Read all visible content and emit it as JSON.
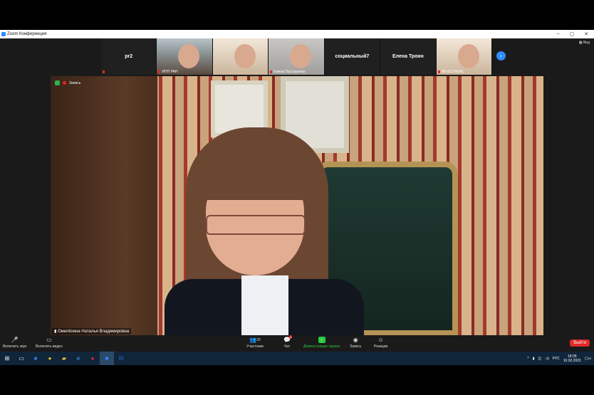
{
  "window": {
    "title": "Zoom Конференция",
    "controls": [
      "–",
      "▢",
      "✕"
    ]
  },
  "view_button": "Вид",
  "gallery": [
    {
      "type": "name",
      "label": "pr2",
      "muted": true
    },
    {
      "type": "video",
      "label": "ИПП РАН",
      "muted": true,
      "style": "vid1"
    },
    {
      "type": "video",
      "label": "",
      "muted": false,
      "style": "vid2"
    },
    {
      "type": "video",
      "label": "Елена Пастушенко",
      "muted": true,
      "style": "vid3"
    },
    {
      "type": "name",
      "label": "социальный7",
      "muted": false
    },
    {
      "type": "name",
      "label": "Елена Троян",
      "muted": false
    },
    {
      "type": "video",
      "label": "ИВ-823 MSAL",
      "muted": true,
      "style": "vid2"
    }
  ],
  "main": {
    "recording_label": "Запись",
    "speaker_name": "Омелёхина Наталья Владимировна"
  },
  "toolbar": {
    "audio": "Включить звук",
    "video": "Включить видео",
    "participants": "Участники",
    "participants_count": "20",
    "chat": "Чат",
    "chat_badge": "1",
    "share": "Демонстрация экрана",
    "record": "Запись",
    "reactions": "Реакции",
    "leave": "Выйти"
  },
  "taskbar": {
    "apps": [
      "start-icon",
      "task-view-icon",
      "outlook-icon",
      "chrome-icon",
      "explorer-icon",
      "edge-icon",
      "yandex-icon",
      "zoom-icon",
      "word-icon"
    ],
    "lang": "РУС",
    "time": "18:05",
    "date": "10.02.2021",
    "notifications": "20"
  }
}
